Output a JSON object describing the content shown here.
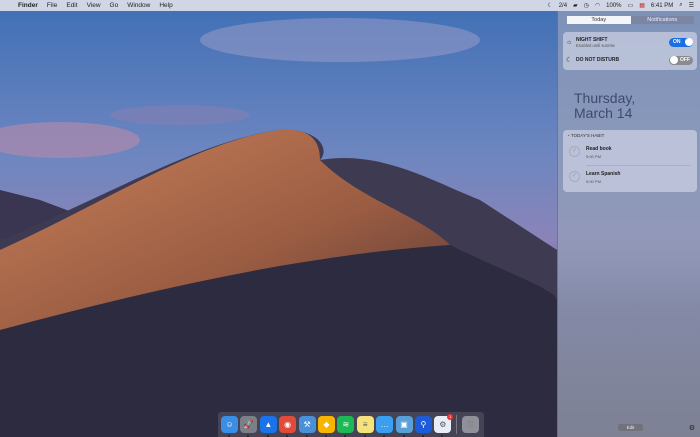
{
  "menubar": {
    "apple": "",
    "app": "Finder",
    "items": [
      "File",
      "Edit",
      "View",
      "Go",
      "Window",
      "Help"
    ],
    "status": {
      "workspace": "2/4",
      "battery": "100%",
      "time": "6:41 PM"
    }
  },
  "notification_center": {
    "tabs": [
      {
        "label": "Today",
        "selected": true
      },
      {
        "label": "Notifications",
        "selected": false
      }
    ],
    "night_shift": {
      "title": "NIGHT SHIFT",
      "subtitle": "Enabled until sunrise",
      "state": "ON"
    },
    "dnd": {
      "title": "DO NOT DISTURB",
      "state": "OFF"
    },
    "date_line1": "Thursday,",
    "date_line2": "March 14",
    "habit_widget": {
      "title": "TODAY'S HABIT",
      "items": [
        {
          "name": "Read book",
          "time": "9:00 PM"
        },
        {
          "name": "Learn Spanish",
          "time": "9:00 PM"
        }
      ]
    },
    "edit_label": "Edit"
  },
  "dock": {
    "apps": [
      {
        "name": "Finder",
        "color": "#3a8ee6",
        "glyph": "☺"
      },
      {
        "name": "Launchpad",
        "color": "#7a7f88",
        "glyph": "🚀"
      },
      {
        "name": "Safari",
        "color": "#1a73e8",
        "glyph": "▲"
      },
      {
        "name": "Chrome",
        "color": "#e04b3a",
        "glyph": "◉"
      },
      {
        "name": "Xcode",
        "color": "#4a90d9",
        "glyph": "⚒"
      },
      {
        "name": "Sketch",
        "color": "#f7b500",
        "glyph": "◆"
      },
      {
        "name": "Spotify",
        "color": "#1db954",
        "glyph": "≋"
      },
      {
        "name": "Notes",
        "color": "#f5e27a",
        "glyph": "≡"
      },
      {
        "name": "Messages",
        "color": "#3a9ff0",
        "glyph": "…"
      },
      {
        "name": "Preview",
        "color": "#5aa0d8",
        "glyph": "▣"
      },
      {
        "name": "Maps",
        "color": "#1e5bd8",
        "glyph": "⚲"
      },
      {
        "name": "Xcode Helper",
        "color": "#e8eef8",
        "glyph": "⚙"
      }
    ],
    "badge": "1",
    "trash": "Trash"
  }
}
